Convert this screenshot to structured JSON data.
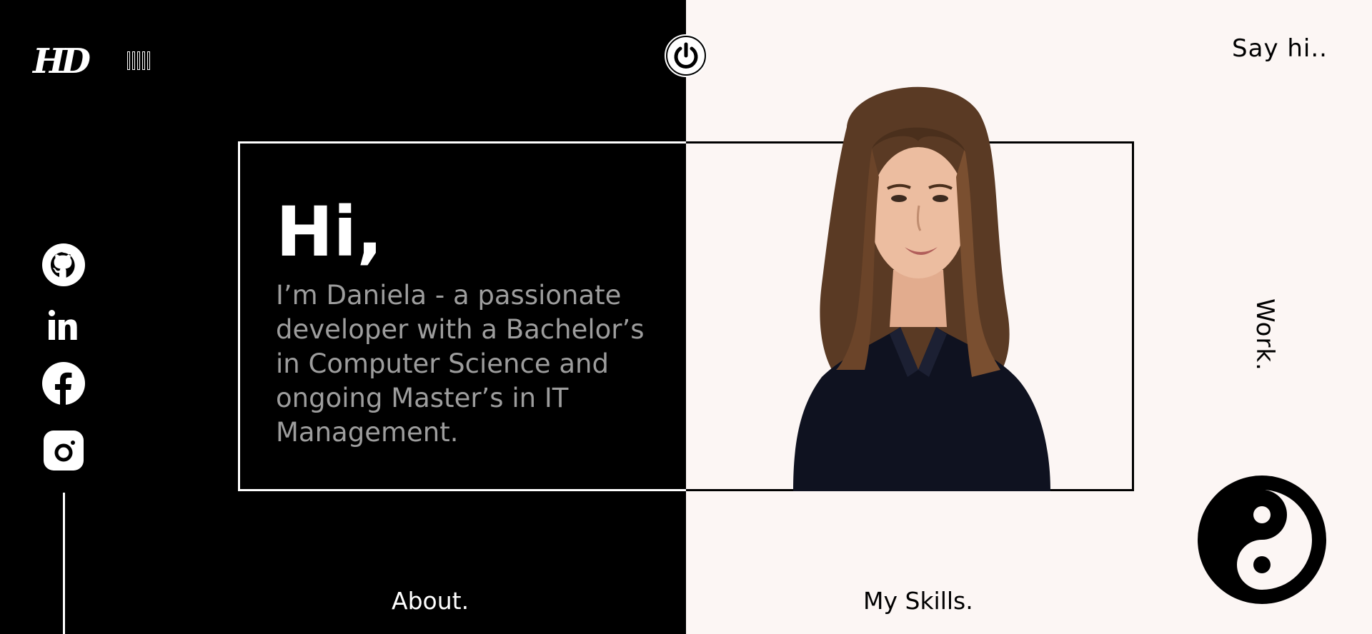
{
  "logo": {
    "text": "HD"
  },
  "nav": {
    "say_hi": "Say hi..",
    "work": "Work.",
    "about": "About.",
    "skills": "My Skills."
  },
  "hero": {
    "greeting": "Hi,",
    "intro": "I’m Daniela - a passionate developer with a Bachelor’s in Computer Science and ongoing Master’s in IT Management."
  },
  "social": [
    "github-icon",
    "linkedin-icon",
    "facebook-icon",
    "instagram-icon"
  ],
  "icons": {
    "power": "power-icon",
    "theme": "yin-yang-icon",
    "menu": "menu-bars-icon"
  },
  "colors": {
    "dark": "#000000",
    "light": "#fcf6f4",
    "muted_text": "#9d9d9d"
  }
}
